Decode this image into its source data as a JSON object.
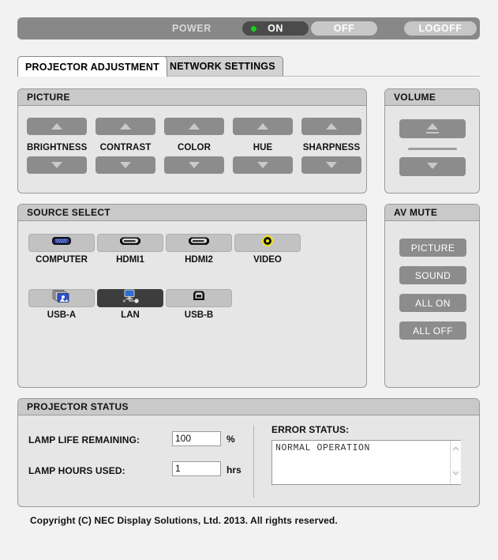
{
  "power": {
    "label": "POWER",
    "on_label": "ON",
    "off_label": "OFF",
    "logoff_label": "LOGOFF",
    "state": "ON",
    "led_color": "#19d119",
    "on_button_bg": "#4b4b4b"
  },
  "tabs": [
    {
      "label": "PROJECTOR ADJUSTMENT",
      "active": true
    },
    {
      "label": "NETWORK SETTINGS",
      "active": false
    }
  ],
  "picture": {
    "title": "PICTURE",
    "controls": [
      {
        "label": "BRIGHTNESS",
        "up_icon": "triangle-up-icon",
        "down_icon": "triangle-down-icon"
      },
      {
        "label": "CONTRAST",
        "up_icon": "triangle-up-icon",
        "down_icon": "triangle-down-icon"
      },
      {
        "label": "COLOR",
        "up_icon": "triangle-up-icon",
        "down_icon": "triangle-down-icon"
      },
      {
        "label": "HUE",
        "up_icon": "triangle-up-icon",
        "down_icon": "triangle-down-icon"
      },
      {
        "label": "SHARPNESS",
        "up_icon": "triangle-up-icon",
        "down_icon": "triangle-down-icon"
      }
    ]
  },
  "volume": {
    "title": "VOLUME",
    "up_icon": "volume-up-icon",
    "down_icon": "volume-down-icon"
  },
  "source_select": {
    "title": "SOURCE SELECT",
    "sources": [
      {
        "label": "COMPUTER",
        "icon": "vga-connector-icon",
        "selected": false
      },
      {
        "label": "HDMI1",
        "icon": "hdmi-connector-icon",
        "selected": false
      },
      {
        "label": "HDMI2",
        "icon": "hdmi-connector-icon",
        "selected": false
      },
      {
        "label": "VIDEO",
        "icon": "rca-video-jack-icon",
        "selected": false
      },
      {
        "label": "USB-A",
        "icon": "usb-a-photos-icon",
        "selected": false
      },
      {
        "label": "LAN",
        "icon": "lan-network-icon",
        "selected": true
      },
      {
        "label": "USB-B",
        "icon": "usb-b-port-icon",
        "selected": false
      }
    ],
    "selected": "LAN"
  },
  "av_mute": {
    "title": "AV MUTE",
    "buttons": [
      {
        "label": "PICTURE"
      },
      {
        "label": "SOUND"
      },
      {
        "label": "ALL ON"
      },
      {
        "label": "ALL OFF"
      }
    ]
  },
  "projector_status": {
    "title": "PROJECTOR STATUS",
    "lamp_life_label": "LAMP LIFE REMAINING:",
    "lamp_life_value": "100",
    "lamp_life_unit": "%",
    "lamp_hours_label": "LAMP HOURS USED:",
    "lamp_hours_value": "1",
    "lamp_hours_unit": "hrs",
    "error_status_label": "ERROR STATUS:",
    "error_status_value": "NORMAL OPERATION",
    "scroll_up_icon": "chevron-up-icon",
    "scroll_down_icon": "chevron-down-icon"
  },
  "footer": {
    "copyright": "Copyright (C) NEC Display Solutions, Ltd. 2013. All rights reserved."
  }
}
